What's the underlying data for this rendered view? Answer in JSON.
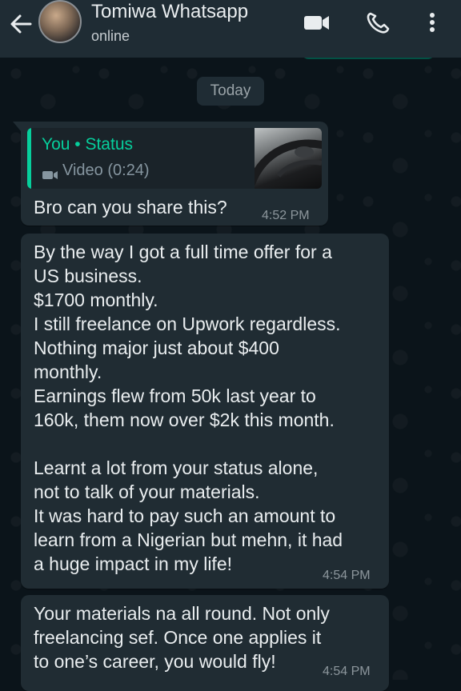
{
  "header": {
    "contact_name": "Tomiwa Whatsapp",
    "contact_status": "online",
    "icons": [
      "back-arrow-icon",
      "video-call-icon",
      "phone-icon",
      "more-vert-icon"
    ]
  },
  "chat": {
    "date_separator": "Today",
    "messages": [
      {
        "quote": {
          "author": "You • Status",
          "media": "Video (0:24)"
        },
        "text": "Bro can you share this?",
        "time": "4:52 PM"
      },
      {
        "text_part1": "By the way I got a full time offer for a\nUS business.\n$1700 monthly.\nI still freelance on Upwork regardless.\nNothing major just about $400\nmonthly.\nEarnings flew from 50k last year to\n160k, them now over $2k this month.",
        "text_part2": "Learnt a lot from your status alone,\nnot to talk of your materials.\nIt was hard to pay such an amount to\nlearn from a Nigerian but mehn, it had\na huge impact in my life!",
        "time": "4:54 PM"
      },
      {
        "text": "Your materials na all round. Not only\nfreelancing sef. Once one applies it\nto one’s career, you would fly!",
        "time": "4:54 PM"
      }
    ]
  },
  "colors": {
    "background": "#0b141a",
    "header": "#1f2c34",
    "bubble": "#202c33",
    "accent": "#06cf9c",
    "text": "#e9edef",
    "meta": "#8c969c"
  }
}
